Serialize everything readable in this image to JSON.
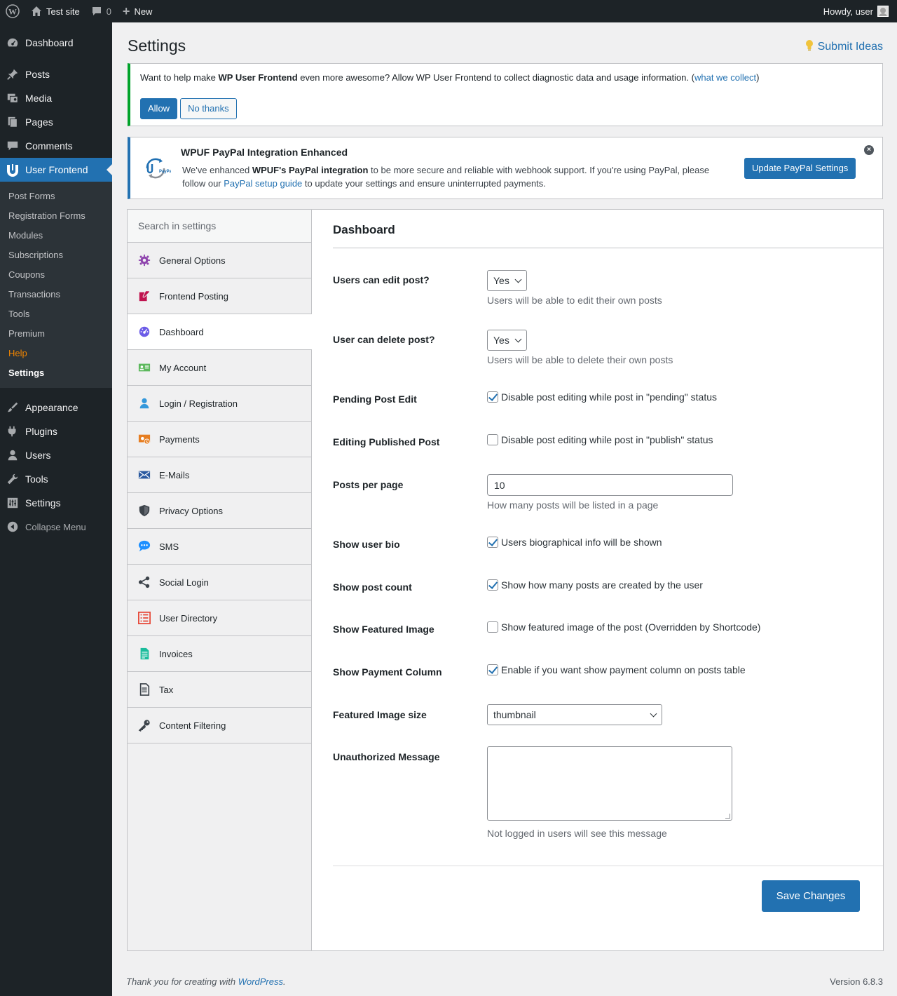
{
  "adminbar": {
    "site_name": "Test site",
    "comments_count": "0",
    "new_label": "New",
    "howdy": "Howdy, user"
  },
  "menu": {
    "top_items": [
      {
        "label": "Dashboard",
        "icon": "dashboard-icon"
      },
      {
        "label": "Posts",
        "icon": "pin-icon"
      },
      {
        "label": "Media",
        "icon": "media-icon"
      },
      {
        "label": "Pages",
        "icon": "pages-icon"
      },
      {
        "label": "Comments",
        "icon": "comment-icon"
      },
      {
        "label": "User Frontend",
        "icon": "wpuf-icon"
      }
    ],
    "submenu": [
      "Post Forms",
      "Registration Forms",
      "Modules",
      "Subscriptions",
      "Coupons",
      "Transactions",
      "Tools",
      "Premium",
      "Help",
      "Settings"
    ],
    "bottom_items": [
      {
        "label": "Appearance",
        "icon": "brush-icon"
      },
      {
        "label": "Plugins",
        "icon": "plug-icon"
      },
      {
        "label": "Users",
        "icon": "users-icon"
      },
      {
        "label": "Tools",
        "icon": "wrench-icon"
      },
      {
        "label": "Settings",
        "icon": "settings-icon"
      }
    ],
    "collapse": "Collapse Menu"
  },
  "page": {
    "title": "Settings",
    "submit_ideas": "Submit Ideas"
  },
  "notice_tracking": {
    "text_before": "Want to help make ",
    "text_bold": "WP User Frontend",
    "text_after": " even more awesome? Allow WP User Frontend to collect diagnostic data and usage information. (",
    "link": "what we collect",
    "text_end": ")",
    "allow": "Allow",
    "no_thanks": "No thanks"
  },
  "notice_paypal": {
    "title": "WPUF PayPal Integration Enhanced",
    "t1": "We've enhanced ",
    "t2": "WPUF's PayPal integration",
    "t3": " to be more secure and reliable with webhook support. If you're using PayPal, please follow our ",
    "link": "PayPal setup guide",
    "t4": " to update your settings and ensure uninterrupted payments.",
    "button": "Update PayPal Settings"
  },
  "settings_nav": {
    "search_placeholder": "Search in settings",
    "items": [
      {
        "label": "General Options",
        "icon": "gear-icon",
        "color": "#8e44ad"
      },
      {
        "label": "Frontend Posting",
        "icon": "edit-icon",
        "color": "#c0134f"
      },
      {
        "label": "Dashboard",
        "icon": "gauge-icon",
        "color": "#6c5ce7"
      },
      {
        "label": "My Account",
        "icon": "id-card-icon",
        "color": "#5cb85c"
      },
      {
        "label": "Login / Registration",
        "icon": "user-icon",
        "color": "#3498db"
      },
      {
        "label": "Payments",
        "icon": "payment-icon",
        "color": "#e67e22"
      },
      {
        "label": "E-Mails",
        "icon": "envelope-icon",
        "color": "#2c5aa0"
      },
      {
        "label": "Privacy Options",
        "icon": "shield-icon",
        "color": "#3c434a"
      },
      {
        "label": "SMS",
        "icon": "chat-icon",
        "color": "#1e90ff"
      },
      {
        "label": "Social Login",
        "icon": "share-icon",
        "color": "#3c434a"
      },
      {
        "label": "User Directory",
        "icon": "list-icon",
        "color": "#e74c3c"
      },
      {
        "label": "Invoices",
        "icon": "invoice-icon",
        "color": "#1abc9c"
      },
      {
        "label": "Tax",
        "icon": "document-icon",
        "color": "#3c434a"
      },
      {
        "label": "Content Filtering",
        "icon": "key-icon",
        "color": "#3c434a"
      }
    ]
  },
  "dashboard_settings": {
    "heading": "Dashboard",
    "edit_post": {
      "label": "Users can edit post?",
      "value": "Yes",
      "desc": "Users will be able to edit their own posts"
    },
    "delete_post": {
      "label": "User can delete post?",
      "value": "Yes",
      "desc": "Users will be able to delete their own posts"
    },
    "pending_edit": {
      "label": "Pending Post Edit",
      "checked": true,
      "text": "Disable post editing while post in \"pending\" status"
    },
    "published_edit": {
      "label": "Editing Published Post",
      "checked": false,
      "text": "Disable post editing while post in \"publish\" status"
    },
    "per_page": {
      "label": "Posts per page",
      "value": "10",
      "desc": "How many posts will be listed in a page"
    },
    "user_bio": {
      "label": "Show user bio",
      "checked": true,
      "text": "Users biographical info will be shown"
    },
    "post_count": {
      "label": "Show post count",
      "checked": true,
      "text": "Show how many posts are created by the user"
    },
    "featured_image": {
      "label": "Show Featured Image",
      "checked": false,
      "text": "Show featured image of the post (Overridden by Shortcode)"
    },
    "payment_column": {
      "label": "Show Payment Column",
      "checked": true,
      "text": "Enable if you want show payment column on posts table"
    },
    "image_size": {
      "label": "Featured Image size",
      "value": "thumbnail"
    },
    "unauth_msg": {
      "label": "Unauthorized Message",
      "value": "",
      "desc": "Not logged in users will see this message"
    },
    "save": "Save Changes"
  },
  "footer": {
    "thanks_before": "Thank you for creating with ",
    "thanks_link": "WordPress",
    "thanks_after": ".",
    "version": "Version 6.8.3"
  }
}
